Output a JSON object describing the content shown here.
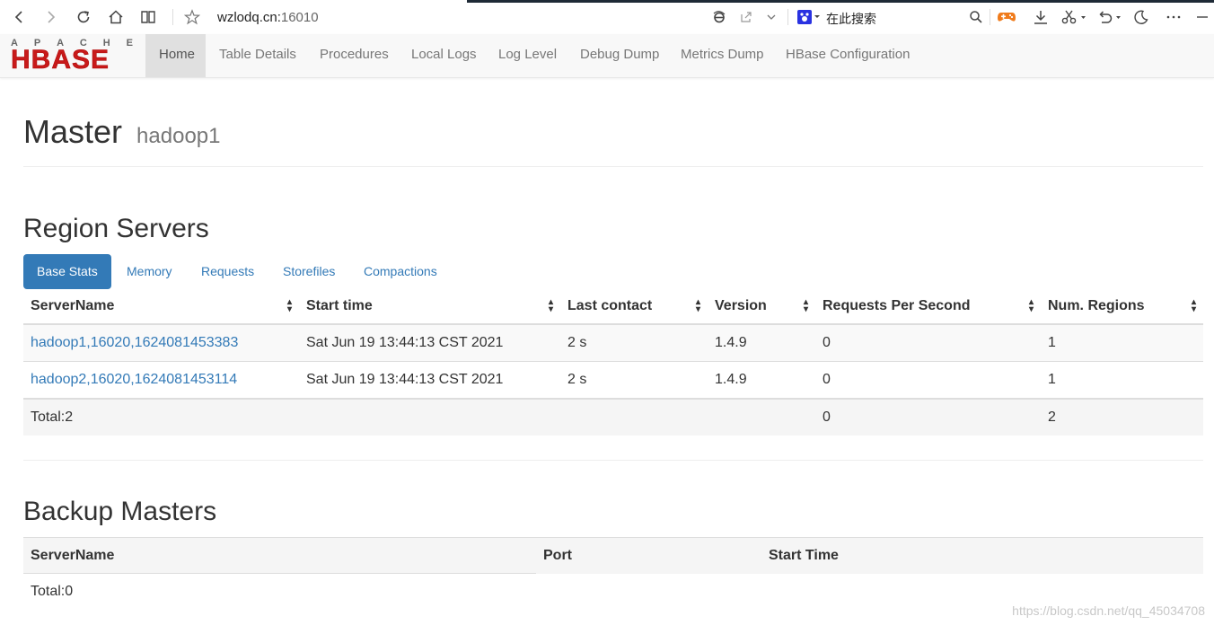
{
  "browser": {
    "url_host": "wzlodq.cn:",
    "url_port": "16010",
    "search_placeholder": "在此搜索"
  },
  "nav": {
    "logo_top": "APACHE",
    "logo_main": "HBASE",
    "items": [
      {
        "label": "Home",
        "active": true
      },
      {
        "label": "Table Details"
      },
      {
        "label": "Procedures"
      },
      {
        "label": "Local Logs"
      },
      {
        "label": "Log Level"
      },
      {
        "label": "Debug Dump"
      },
      {
        "label": "Metrics Dump"
      },
      {
        "label": "HBase Configuration"
      }
    ]
  },
  "header": {
    "title": "Master",
    "host": "hadoop1"
  },
  "region_servers": {
    "heading": "Region Servers",
    "tabs": [
      "Base Stats",
      "Memory",
      "Requests",
      "Storefiles",
      "Compactions"
    ],
    "columns": [
      "ServerName",
      "Start time",
      "Last contact",
      "Version",
      "Requests Per Second",
      "Num. Regions"
    ],
    "rows": [
      {
        "server": "hadoop1,16020,1624081453383",
        "start": "Sat Jun 19 13:44:13 CST 2021",
        "contact": "2 s",
        "version": "1.4.9",
        "rps": "0",
        "regions": "1"
      },
      {
        "server": "hadoop2,16020,1624081453114",
        "start": "Sat Jun 19 13:44:13 CST 2021",
        "contact": "2 s",
        "version": "1.4.9",
        "rps": "0",
        "regions": "1"
      }
    ],
    "total": {
      "label": "Total:2",
      "rps": "0",
      "regions": "2"
    }
  },
  "backup_masters": {
    "heading": "Backup Masters",
    "columns": [
      "ServerName",
      "Port",
      "Start Time"
    ],
    "total": "Total:0"
  },
  "watermark": "https://blog.csdn.net/qq_45034708"
}
